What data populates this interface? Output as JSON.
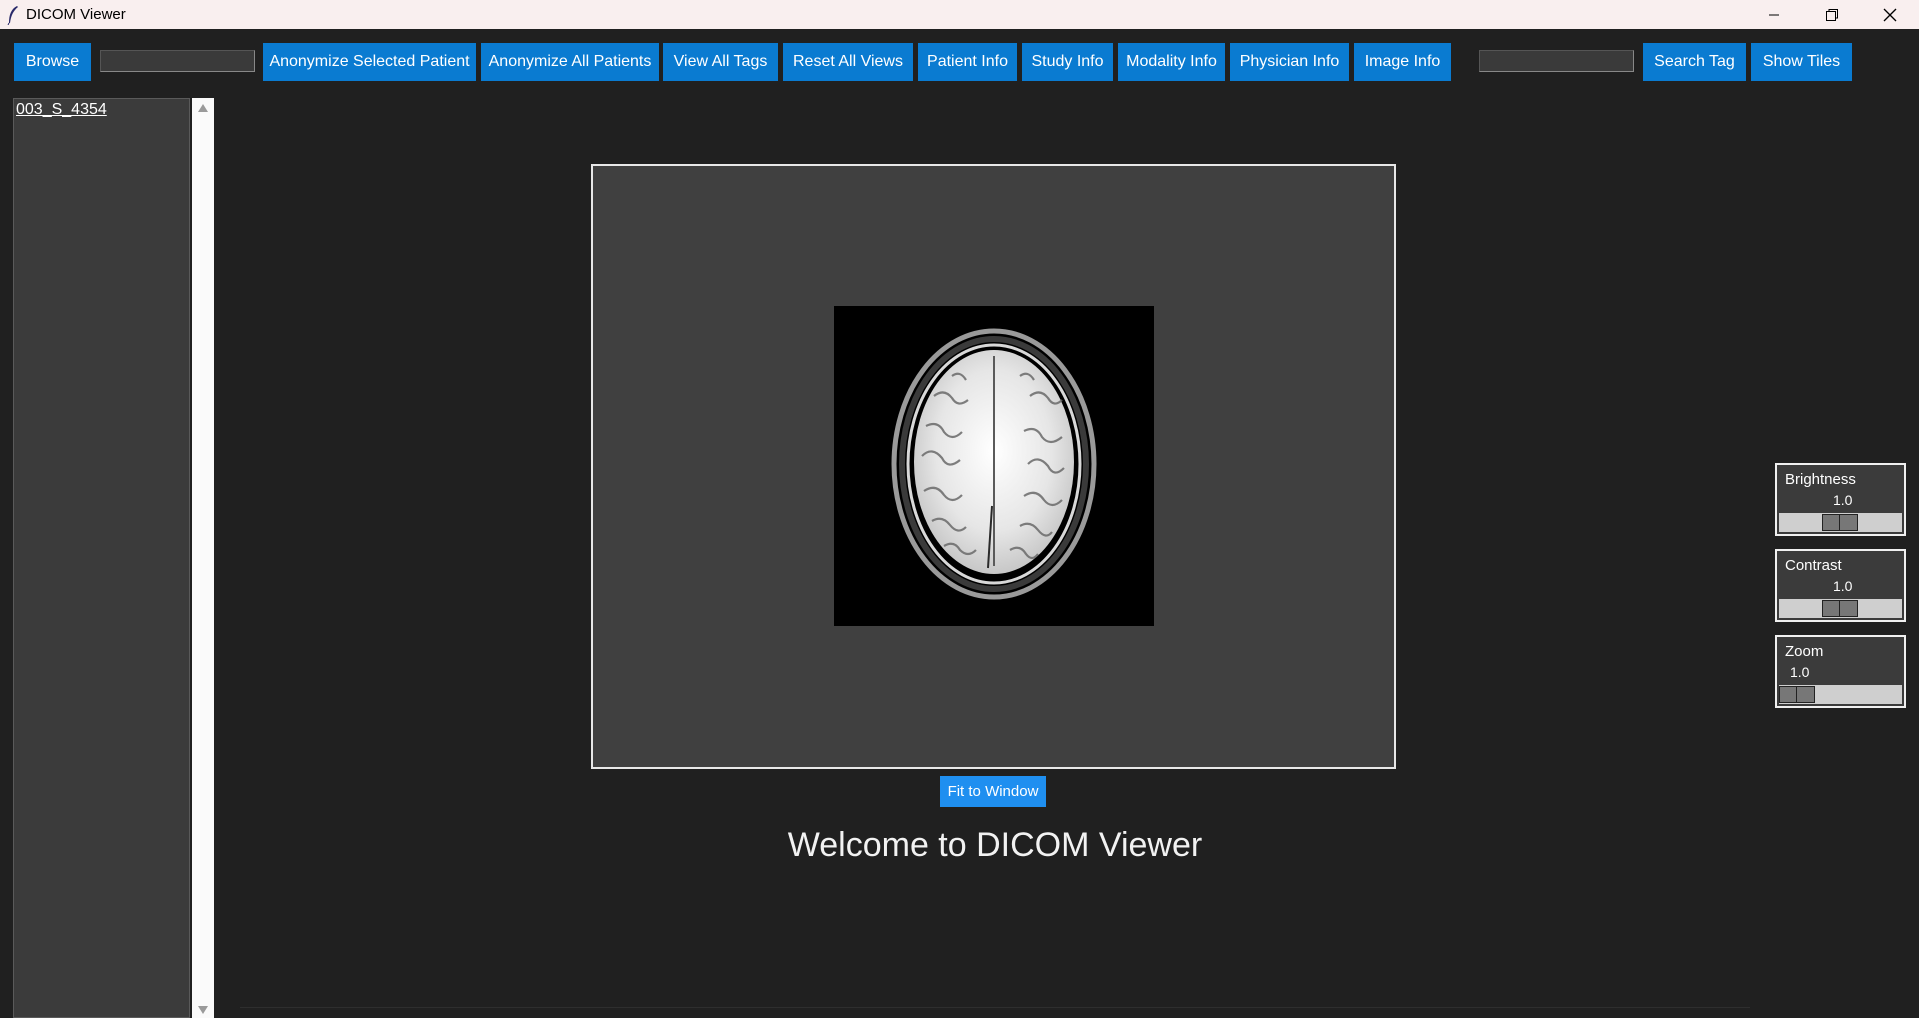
{
  "window": {
    "title": "DICOM Viewer",
    "controls": [
      "minimize",
      "restore",
      "close"
    ]
  },
  "toolbar": {
    "browse_label": "Browse",
    "path_value": "",
    "anonymize_selected_label": "Anonymize Selected Patient",
    "anonymize_all_label": "Anonymize All Patients",
    "view_all_tags_label": "View All Tags",
    "reset_all_views_label": "Reset All Views",
    "patient_info_label": "Patient Info",
    "study_info_label": "Study Info",
    "modality_info_label": "Modality Info",
    "physician_info_label": "Physician Info",
    "image_info_label": "Image Info",
    "search_value": "",
    "search_tag_label": "Search Tag",
    "show_tiles_label": "Show Tiles"
  },
  "patients": {
    "items": [
      "003_S_4354"
    ]
  },
  "viewer": {
    "fit_to_window_label": "Fit to Window",
    "welcome_text": "Welcome to DICOM Viewer"
  },
  "controls": {
    "brightness": {
      "label": "Brightness",
      "value": "1.0",
      "position": 0.5
    },
    "contrast": {
      "label": "Contrast",
      "value": "1.0",
      "position": 0.5
    },
    "zoom": {
      "label": "Zoom",
      "value": "1.0",
      "position": 0.0
    }
  },
  "colors": {
    "button": "#0a7bd1",
    "fit_button": "#1f8ff0",
    "background": "#202020",
    "panel": "#3b3b3b",
    "viewer_bg": "#404040"
  }
}
